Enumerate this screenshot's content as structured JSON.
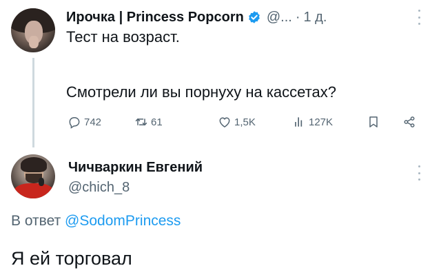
{
  "tweet": {
    "author_name": "Ирочка | Princess Popcorn",
    "author_handle": "@...",
    "separator": "·",
    "time": "1 д.",
    "text_line1": "Тест на возраст.",
    "text_line2": "Смотрели ли вы порнуху на кассетах?",
    "actions": {
      "replies": "742",
      "retweets": "61",
      "likes": "1,5K",
      "views": "127K"
    }
  },
  "reply": {
    "author_name": "Чичваркин Евгений",
    "author_handle": "@chich_8",
    "reply_prefix": "В ответ",
    "reply_mention": "@SodomPrincess",
    "text": "Я ей торговал"
  },
  "colors": {
    "text": "#0f1419",
    "secondary": "#536471",
    "accent": "#1d9bf0",
    "thread_line": "#cfd9de"
  },
  "icons": [
    "reply-icon",
    "retweet-icon",
    "like-icon",
    "views-icon",
    "bookmark-icon",
    "share-icon",
    "verified-badge-icon",
    "more-icon"
  ]
}
